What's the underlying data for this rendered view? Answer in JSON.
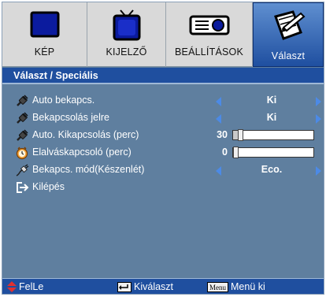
{
  "tabs": [
    {
      "label": "KÉP",
      "icon": "picture-icon",
      "selected": false
    },
    {
      "label": "KIJELZŐ",
      "icon": "tv-display-icon",
      "selected": false
    },
    {
      "label": "BEÁLLÍTÁSOK",
      "icon": "projector-settings-icon",
      "selected": false
    },
    {
      "label": "Választ",
      "icon": "notepad-options-icon",
      "selected": true
    }
  ],
  "breadcrumb": "Választ / Speciális",
  "items": [
    {
      "label": "Auto bekapcs.",
      "icon": "power-plug-icon",
      "value": "Ki"
    },
    {
      "label": "Bekapcsolás jelre",
      "icon": "power-plug-icon",
      "value": "Ki"
    },
    {
      "label": "Auto. Kikapcsolás (perc)",
      "icon": "power-plug-icon",
      "value": "30",
      "level": 0.06
    },
    {
      "label": "Elalváskapcsoló (perc)",
      "icon": "clock-icon",
      "value": "0",
      "level": 0.0
    },
    {
      "label": "Bekapcs. mód(Készenlét)",
      "icon": "power-cord-icon",
      "value": "Eco."
    },
    {
      "label": "Kilépés",
      "icon": "exit-icon"
    }
  ],
  "footer": {
    "nav": "FelLe",
    "select": "Kiválaszt",
    "menu_key": "Menu",
    "menu": "Menü ki"
  },
  "colors": {
    "tab_bar": "#d9d9d9",
    "selected_tab": "#2b5db0",
    "header_bar": "#1f4f9f",
    "content_bg": "#5f7f9f",
    "arrow": "#4c8ae6",
    "nav_arrow": "#e23030"
  }
}
